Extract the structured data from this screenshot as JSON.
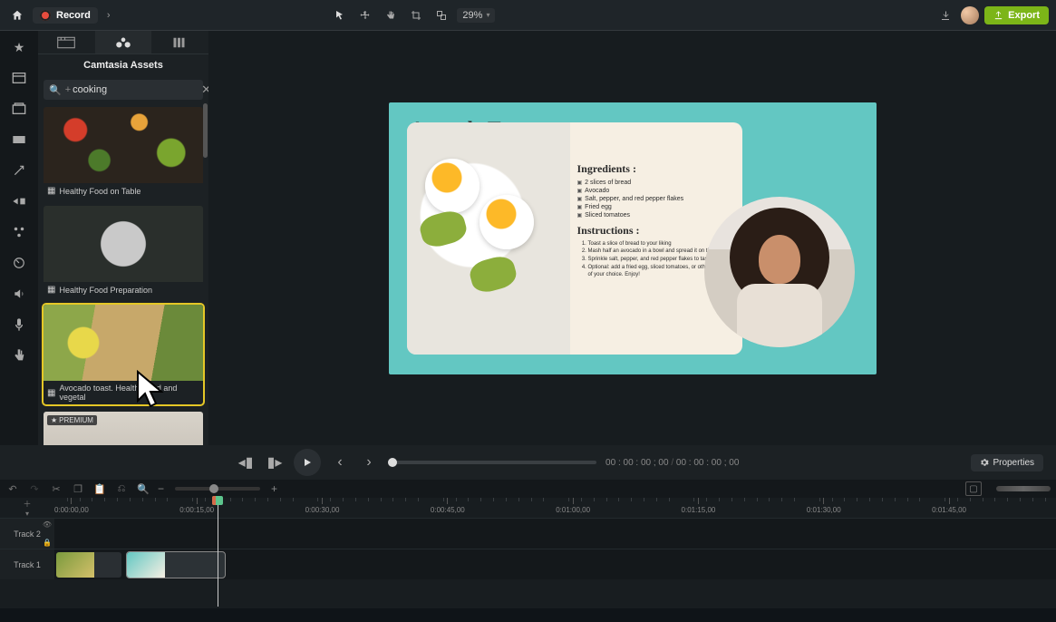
{
  "topbar": {
    "record_label": "Record",
    "zoom_value": "29%",
    "export_label": "Export"
  },
  "panel": {
    "title": "Camtasia Assets",
    "search_value": "cooking",
    "search_prefix": "+"
  },
  "assets": {
    "item0": {
      "caption": "Healthy Food on Table"
    },
    "item1": {
      "caption": "Healthy Food Preparation"
    },
    "item2": {
      "caption": "Avocado toast. Healthy food and vegetal"
    },
    "item3": {
      "premium": "PREMIUM"
    }
  },
  "canvas": {
    "title": "Avocado Toast",
    "ingredients_h": "Ingredients :",
    "ingredients": {
      "i0": "2 slices of bread",
      "i1": "Avocado",
      "i2": "Salt, pepper, and red pepper flakes",
      "i3": "Fried egg",
      "i4": "Sliced tomatoes"
    },
    "instructions_h": "Instructions :",
    "instructions": {
      "s0": "Toast a slice of bread to your liking",
      "s1": "Mash half an avocado in a bowl and spread it on the toast",
      "s2": "Sprinkle salt, pepper, and red pepper flakes to taste",
      "s3": "Optional: add a fried egg, sliced tomatoes, or other toppings of your choice. Enjoy!"
    }
  },
  "playback": {
    "cur": "00 : 00 : 00 ; 00",
    "total": "00 : 00 : 00 ; 00",
    "properties_label": "Properties"
  },
  "ruler": {
    "t0": "0:00:00,00",
    "t1": "0:00:15,00",
    "t2": "0:00:30,00",
    "t3": "0:00:45,00",
    "t4": "0:01:00,00",
    "t5": "0:01:15,00",
    "t6": "0:01:30,00",
    "t7": "0:01:45,00"
  },
  "tracks": {
    "track2": "Track 2",
    "track1": "Track 1"
  }
}
